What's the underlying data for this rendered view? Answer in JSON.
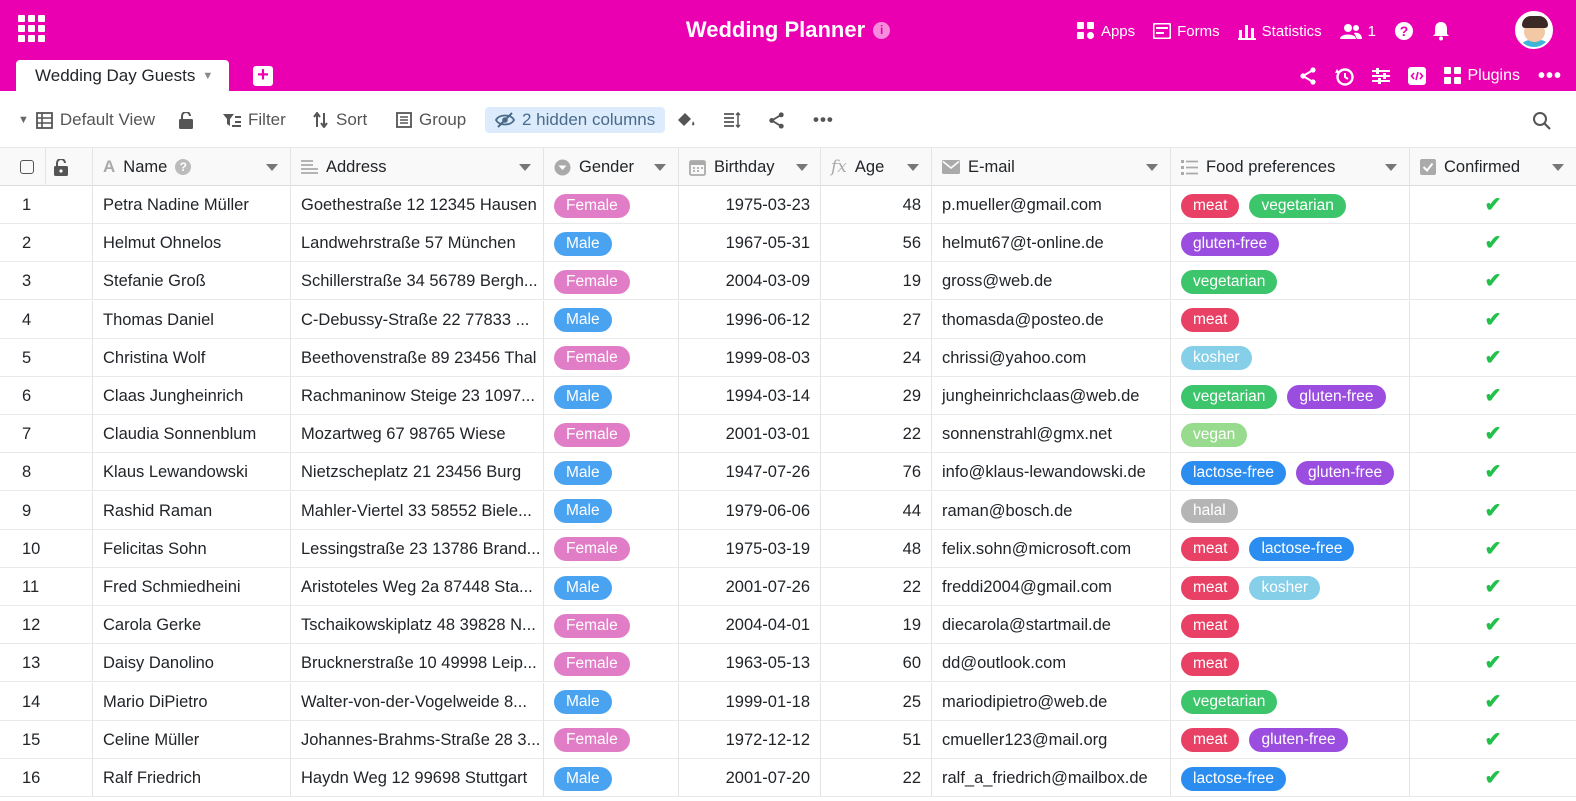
{
  "app": {
    "title": "Wedding Planner",
    "brand_color": "#eb00b1",
    "header_actions": [
      {
        "label": "Apps",
        "icon": "apps-icon"
      },
      {
        "label": "Forms",
        "icon": "forms-icon"
      },
      {
        "label": "Statistics",
        "icon": "statistics-icon"
      }
    ],
    "collaborators_count": "1"
  },
  "tabs": {
    "active": "Wedding Day Guests",
    "right_label": "Plugins"
  },
  "toolbar": {
    "view": "Default View",
    "filter": "Filter",
    "sort": "Sort",
    "group": "Group",
    "hidden_columns": "2 hidden columns"
  },
  "columns": {
    "name": "Name",
    "address": "Address",
    "gender": "Gender",
    "birthday": "Birthday",
    "age": "Age",
    "email": "E-mail",
    "food": "Food preferences",
    "confirmed": "Confirmed"
  },
  "tag_colors": {
    "Female": "#e07dc6",
    "Male": "#4aa3f0",
    "meat": "#e94065",
    "vegetarian": "#3dc56c",
    "gluten-free": "#9b4de0",
    "kosher": "#86cfe8",
    "vegan": "#99db8e",
    "lactose-free": "#2b8df0",
    "halal": "#b5b5b5"
  },
  "rows": [
    {
      "n": "1",
      "name": "Petra Nadine Müller",
      "address": "Goethestraße 12 12345 Hausen",
      "gender": "Female",
      "birthday": "1975-03-23",
      "age": "48",
      "email": "p.mueller@gmail.com",
      "food": [
        "meat",
        "vegetarian"
      ],
      "confirmed": "✔"
    },
    {
      "n": "2",
      "name": "Helmut Ohnelos",
      "address": "Landwehrstraße 57 München",
      "gender": "Male",
      "birthday": "1967-05-31",
      "age": "56",
      "email": "helmut67@t-online.de",
      "food": [
        "gluten-free"
      ],
      "confirmed": "✔"
    },
    {
      "n": "3",
      "name": "Stefanie Groß",
      "address": "Schillerstraße 34 56789 Bergh...",
      "gender": "Female",
      "birthday": "2004-03-09",
      "age": "19",
      "email": "gross@web.de",
      "food": [
        "vegetarian"
      ],
      "confirmed": "✔"
    },
    {
      "n": "4",
      "name": "Thomas Daniel",
      "address": "C-Debussy-Straße 22 77833 ...",
      "gender": "Male",
      "birthday": "1996-06-12",
      "age": "27",
      "email": "thomasda@posteo.de",
      "food": [
        "meat"
      ],
      "confirmed": "✔"
    },
    {
      "n": "5",
      "name": "Christina Wolf",
      "address": "Beethovenstraße 89 23456 Thal",
      "gender": "Female",
      "birthday": "1999-08-03",
      "age": "24",
      "email": "chrissi@yahoo.com",
      "food": [
        "kosher"
      ],
      "confirmed": "✔"
    },
    {
      "n": "6",
      "name": "Claas Jungheinrich",
      "address": "Rachmaninow Steige 23 1097...",
      "gender": "Male",
      "birthday": "1994-03-14",
      "age": "29",
      "email": "jungheinrichclaas@web.de",
      "food": [
        "vegetarian",
        "gluten-free"
      ],
      "confirmed": "✔"
    },
    {
      "n": "7",
      "name": "Claudia Sonnenblum",
      "address": "Mozartweg 67 98765 Wiese",
      "gender": "Female",
      "birthday": "2001-03-01",
      "age": "22",
      "email": "sonnenstrahl@gmx.net",
      "food": [
        "vegan"
      ],
      "confirmed": "✔"
    },
    {
      "n": "8",
      "name": "Klaus Lewandowski",
      "address": "Nietzscheplatz 21 23456 Burg",
      "gender": "Male",
      "birthday": "1947-07-26",
      "age": "76",
      "email": "info@klaus-lewandowski.de",
      "food": [
        "lactose-free",
        "gluten-free"
      ],
      "confirmed": "✔"
    },
    {
      "n": "9",
      "name": "Rashid Raman",
      "address": "Mahler-Viertel 33 58552 Biele...",
      "gender": "Male",
      "birthday": "1979-06-06",
      "age": "44",
      "email": "raman@bosch.de",
      "food": [
        "halal"
      ],
      "confirmed": "✔"
    },
    {
      "n": "10",
      "name": "Felicitas Sohn",
      "address": "Lessingstraße 23 13786 Brand...",
      "gender": "Female",
      "birthday": "1975-03-19",
      "age": "48",
      "email": "felix.sohn@microsoft.com",
      "food": [
        "meat",
        "lactose-free"
      ],
      "confirmed": "✔"
    },
    {
      "n": "11",
      "name": "Fred Schmiedheini",
      "address": "Aristoteles Weg 2a 87448 Sta...",
      "gender": "Male",
      "birthday": "2001-07-26",
      "age": "22",
      "email": "freddi2004@gmail.com",
      "food": [
        "meat",
        "kosher"
      ],
      "confirmed": "✔"
    },
    {
      "n": "12",
      "name": "Carola Gerke",
      "address": "Tschaikowskiplatz 48 39828 N...",
      "gender": "Female",
      "birthday": "2004-04-01",
      "age": "19",
      "email": "diecarola@startmail.de",
      "food": [
        "meat"
      ],
      "confirmed": "✔"
    },
    {
      "n": "13",
      "name": "Daisy Danolino",
      "address": "Brucknerstraße 10 49998 Leip...",
      "gender": "Female",
      "birthday": "1963-05-13",
      "age": "60",
      "email": "dd@outlook.com",
      "food": [
        "meat"
      ],
      "confirmed": "✔"
    },
    {
      "n": "14",
      "name": "Mario DiPietro",
      "address": "Walter-von-der-Vogelweide 8...",
      "gender": "Male",
      "birthday": "1999-01-18",
      "age": "25",
      "email": "mariodipietro@web.de",
      "food": [
        "vegetarian"
      ],
      "confirmed": "✔"
    },
    {
      "n": "15",
      "name": "Celine Müller",
      "address": "Johannes-Brahms-Straße 28 3...",
      "gender": "Female",
      "birthday": "1972-12-12",
      "age": "51",
      "email": "cmueller123@mail.org",
      "food": [
        "meat",
        "gluten-free"
      ],
      "confirmed": "✔"
    },
    {
      "n": "16",
      "name": "Ralf Friedrich",
      "address": "Haydn Weg 12 99698 Stuttgart",
      "gender": "Male",
      "birthday": "2001-07-20",
      "age": "22",
      "email": "ralf_a_friedrich@mailbox.de",
      "food": [
        "lactose-free"
      ],
      "confirmed": "✔"
    }
  ]
}
